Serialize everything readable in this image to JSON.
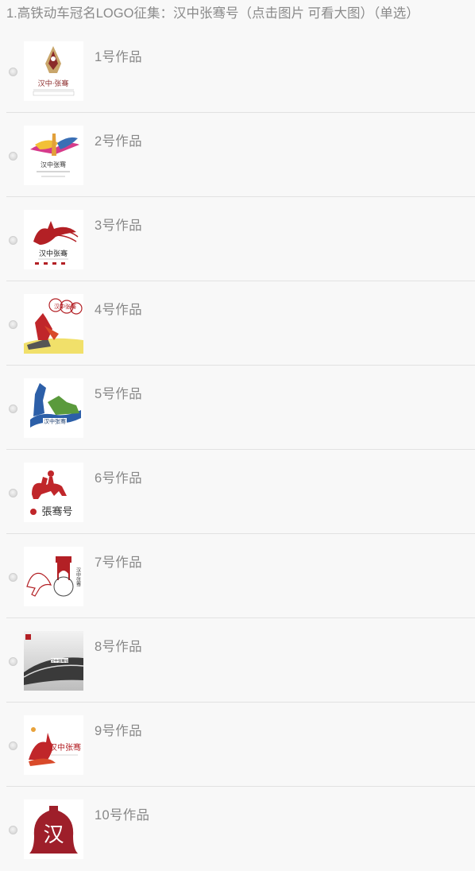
{
  "question": {
    "title": "1.高铁动车冠名LOGO征集：汉中张骞号（点击图片 可看大图）（单选）"
  },
  "options": [
    {
      "label": "1号作品",
      "logo_icon": "logo-1-icon",
      "logo_text": "汉中·张骞"
    },
    {
      "label": "2号作品",
      "logo_icon": "logo-2-icon",
      "logo_text": "汉中张骞"
    },
    {
      "label": "3号作品",
      "logo_icon": "logo-3-icon",
      "logo_text": "汉中张骞"
    },
    {
      "label": "4号作品",
      "logo_icon": "logo-4-icon",
      "logo_text": "汉中张骞"
    },
    {
      "label": "5号作品",
      "logo_icon": "logo-5-icon",
      "logo_text": "汉中张骞"
    },
    {
      "label": "6号作品",
      "logo_icon": "logo-6-icon",
      "logo_text": "張骞号"
    },
    {
      "label": "7号作品",
      "logo_icon": "logo-7-icon",
      "logo_text": "汉中张骞"
    },
    {
      "label": "8号作品",
      "logo_icon": "logo-8-icon",
      "logo_text": "汉中张骞号"
    },
    {
      "label": "9号作品",
      "logo_icon": "logo-9-icon",
      "logo_text": "汉中张骞"
    },
    {
      "label": "10号作品",
      "logo_icon": "logo-10-icon",
      "logo_text": "汉"
    }
  ],
  "colors": {
    "background": "#f8f8f8",
    "divider": "#e2e2e2",
    "text": "#888888",
    "logo_red": "#b32025"
  }
}
